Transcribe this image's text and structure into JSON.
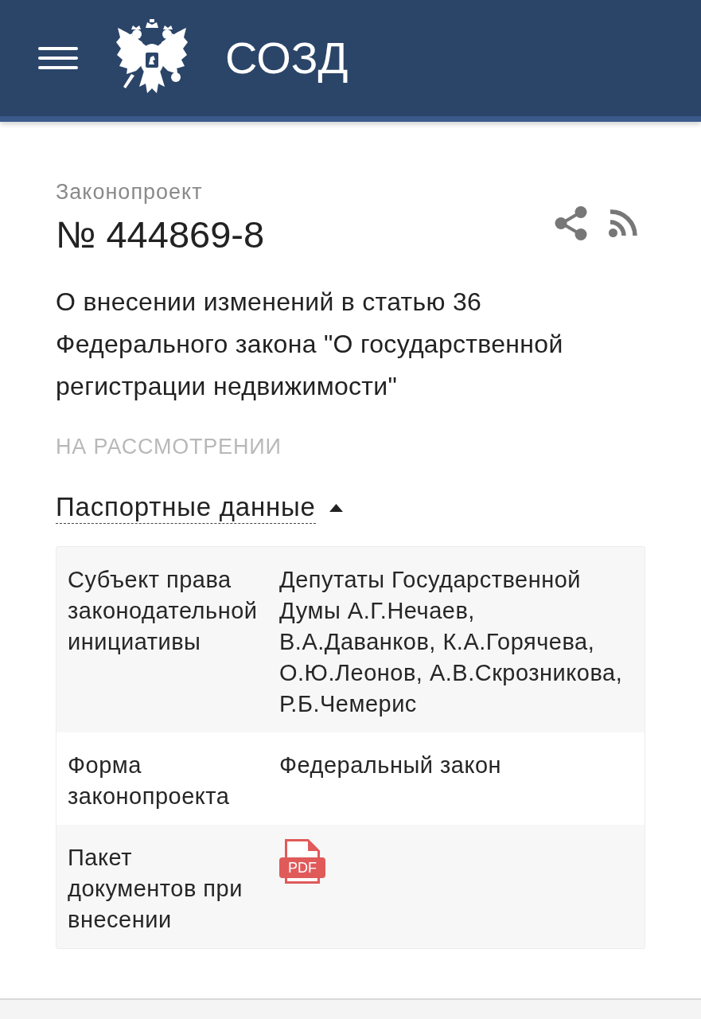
{
  "header": {
    "title": "СОЗД"
  },
  "bill": {
    "label": "Законопроект",
    "number": "№ 444869-8",
    "title": "О внесении изменений в статью 36 Федерального закона \"О государственной регистрации недвижимости\"",
    "status": "НА РАССМОТРЕНИИ"
  },
  "passport": {
    "heading": "Паспортные данные",
    "expanded": true,
    "rows": [
      {
        "kind": "text",
        "label": "Субъект права законодательной инициативы",
        "value": "Депутаты Государственной Думы А.Г.Нечаев, В.А.Даванков, К.А.Горячева, О.Ю.Леонов, А.В.Скрозникова, Р.Б.Чемерис"
      },
      {
        "kind": "text",
        "label": "Форма законопроекта",
        "value": "Федеральный закон"
      },
      {
        "kind": "file",
        "label": "Пакет документов при внесении",
        "file_label": "PDF"
      }
    ]
  }
}
